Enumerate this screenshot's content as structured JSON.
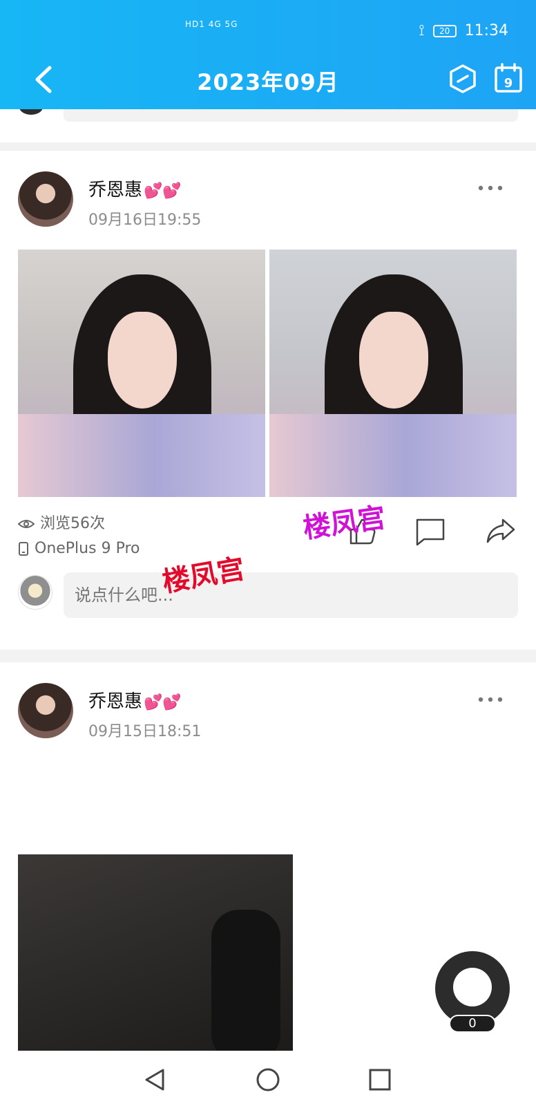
{
  "status_bar": {
    "signal_text": "HD1 4G 5G",
    "battery": "20",
    "time": "11:34"
  },
  "header": {
    "title": "2023年09月"
  },
  "posts": [
    {
      "name": "乔恩惠",
      "hearts": "💕💕",
      "date": "09月16日19:55",
      "views": "浏览56次",
      "device": "OnePlus 9 Pro",
      "comment_placeholder": "说点什么吧..."
    },
    {
      "name": "乔恩惠",
      "hearts": "💕💕",
      "date": "09月15日18:51"
    }
  ],
  "watermark": {
    "text1": "楼凤宫",
    "text2": "楼凤宫"
  },
  "floating_button": {
    "count": "0"
  },
  "colors": {
    "header_start": "#17b6f5",
    "header_end": "#1ea4f5"
  },
  "icons": [
    "back-icon",
    "hexagon-icon",
    "calendar-icon",
    "more-icon",
    "eye-icon",
    "phone-icon",
    "like-icon",
    "comment-icon",
    "share-icon",
    "back-triangle-icon",
    "home-circle-icon",
    "recent-square-icon"
  ]
}
